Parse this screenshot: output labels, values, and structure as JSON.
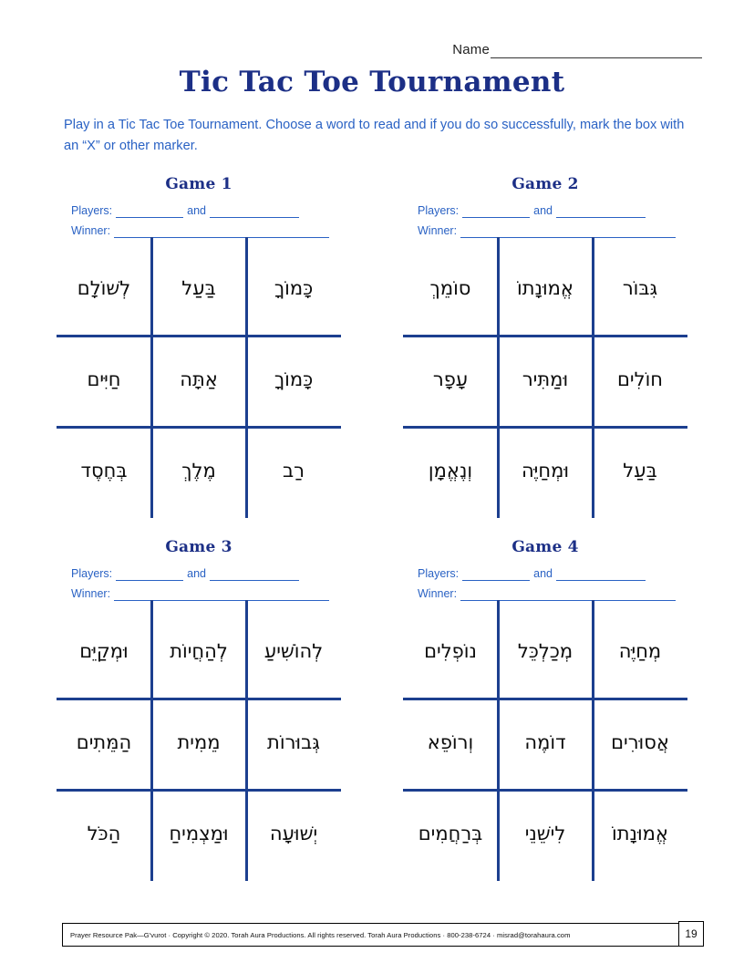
{
  "header": {
    "name_label": "Name",
    "title": "Tic Tac Toe Tournament",
    "instructions": "Play in a Tic Tac Toe Tournament. Choose a word to read and if you do so successfully, mark the box with an “X” or other marker."
  },
  "labels": {
    "players": "Players:",
    "and": "and",
    "winner": "Winner:"
  },
  "games": [
    {
      "title": "Game 1",
      "rows": [
        [
          "לְשׁוֹלָם",
          "בַּעַל",
          "כָּמוֹךָ"
        ],
        [
          "חַיִּים",
          "אַתָּה",
          "כָּמוֹךָ"
        ],
        [
          "בְּחֶסֶד",
          "מֶלֶךְ",
          "רַב"
        ]
      ]
    },
    {
      "title": "Game 2",
      "rows": [
        [
          "סוֹמֵךְ",
          "אֱמוּנָתוֹ",
          "גִּבּוֹר"
        ],
        [
          "עָפָר",
          "וּמַתִּיר",
          "חוֹלִים"
        ],
        [
          "וְנֶאֱמָן",
          "וּמְחַיֶּה",
          "בַּעַל"
        ]
      ]
    },
    {
      "title": "Game 3",
      "rows": [
        [
          "וּמְקַיֵּם",
          "לְהַחֲיוֹת",
          "לְהוֹשִׁיעַ"
        ],
        [
          "הַמֵּתִים",
          "מֵמִית",
          "גְּבוּרוֹת"
        ],
        [
          "הַכֹּל",
          "וּמַצְמִיחַ",
          "יְשׁוּעָה"
        ]
      ]
    },
    {
      "title": "Game 4",
      "rows": [
        [
          "נוֹפְלִים",
          "מְכַלְכֵּל",
          "מְחַיֶּה"
        ],
        [
          "וְרוֹפֵא",
          "דוֹמֶה",
          "אֲסוּרִים"
        ],
        [
          "בְּרַחֲמִים",
          "לִישֵׁנֵי",
          "אֱמוּנָתוֹ"
        ]
      ]
    }
  ],
  "footer": {
    "text": "Prayer Resource Pak—G'vurot · Copyright © 2020. Torah Aura Productions. All rights reserved. Torah Aura Productions · 800-238-6724 · misrad@torahaura.com",
    "page_number": "19"
  },
  "colors": {
    "title_blue": "#1c2f86",
    "text_blue": "#2a62c4",
    "grid_blue": "#1c3f8f",
    "hebrew_black": "#0d0d0d"
  }
}
